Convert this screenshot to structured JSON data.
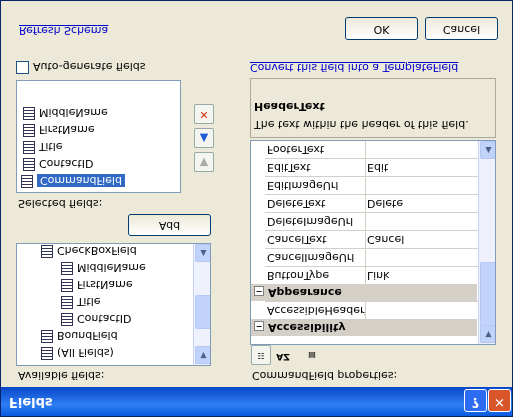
{
  "window": {
    "title": "Fields"
  },
  "available": {
    "label": "Available fields:",
    "items": [
      "(All Fields)",
      "BoundField",
      "ContactID",
      "Title",
      "FirstName",
      "MiddleName",
      "CheckBoxField"
    ]
  },
  "add_label": "Add",
  "selected": {
    "label": "Selected fields:",
    "items": [
      "CommandField",
      "ContactID",
      "Title",
      "FirstName",
      "MiddleName"
    ]
  },
  "autogen_label": "Auto-generate fields",
  "refresh_label": "Refresh Schema",
  "props": {
    "label": "CommandField properties:",
    "categories": [
      "Accessibility",
      "Appearance"
    ],
    "rows": [
      {
        "name": "AccessibleHeaderTe",
        "value": ""
      },
      {
        "name": "ButtonType",
        "value": "Link"
      },
      {
        "name": "CancelImageUrl",
        "value": ""
      },
      {
        "name": "CancelText",
        "value": "Cancel"
      },
      {
        "name": "DeleteImageUrl",
        "value": ""
      },
      {
        "name": "DeleteText",
        "value": "Delete"
      },
      {
        "name": "EditImageUrl",
        "value": ""
      },
      {
        "name": "EditText",
        "value": "Edit"
      },
      {
        "name": "FooterText",
        "value": ""
      }
    ]
  },
  "desc": {
    "title": "HeaderText",
    "text": "The text within the header of this field."
  },
  "convert_label": "Convert this field into a TemplateField",
  "ok_label": "OK",
  "cancel_label": "Cancel",
  "icons": {
    "delete": "delete-x-icon",
    "up": "move-up-icon",
    "down": "move-down-icon"
  }
}
